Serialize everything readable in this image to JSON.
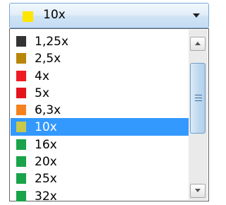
{
  "combo": {
    "selected_label": "10x",
    "selected_color": "#ffe600"
  },
  "items": [
    {
      "label": "1,25x",
      "color": "#333333"
    },
    {
      "label": "2,5x",
      "color": "#b8860b"
    },
    {
      "label": "4x",
      "color": "#ee1c24"
    },
    {
      "label": "5x",
      "color": "#e3141c"
    },
    {
      "label": "6,3x",
      "color": "#f58220"
    },
    {
      "label": "10x",
      "color": "#c8c84a",
      "selected": true
    },
    {
      "label": "16x",
      "color": "#1aa34a"
    },
    {
      "label": "20x",
      "color": "#1aa34a"
    },
    {
      "label": "25x",
      "color": "#1aa34a"
    },
    {
      "label": "32x",
      "color": "#1aa34a"
    }
  ],
  "icons": {
    "dropdown": "chevron-down-icon",
    "scroll_up": "scroll-up-arrow-icon",
    "scroll_down": "scroll-down-arrow-icon",
    "thumb_grip": "grip-icon"
  },
  "colors": {
    "selection": "#3399ff"
  }
}
